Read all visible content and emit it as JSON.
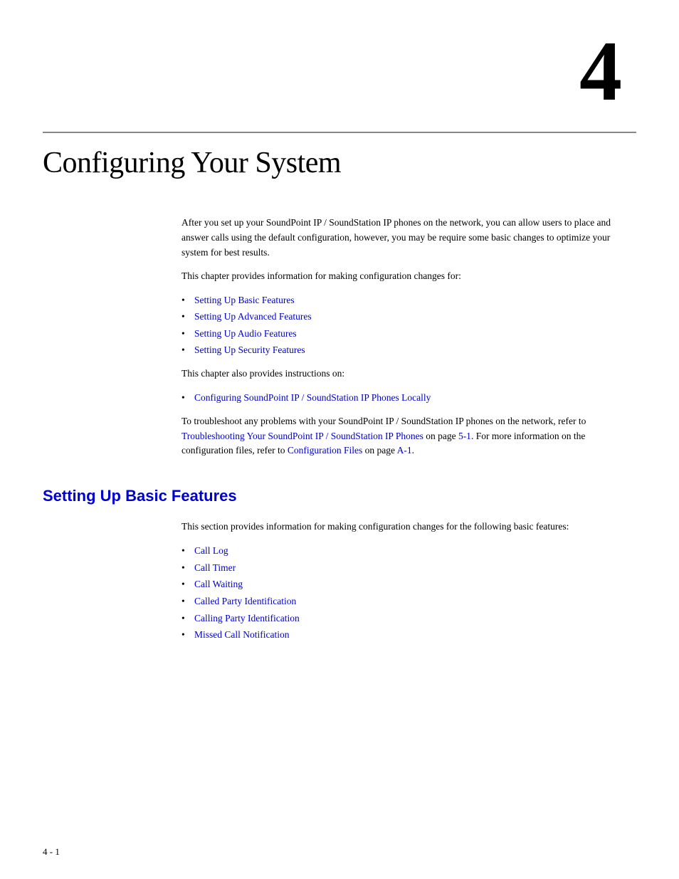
{
  "chapter": {
    "number": "4",
    "title": "Configuring Your System"
  },
  "intro": {
    "paragraph1": "After you set up your SoundPoint IP / SoundStation IP phones on the network, you can allow users to place and answer calls using the default configuration, however, you may be require some basic changes to optimize your system for best results.",
    "paragraph2": "This chapter provides information for making configuration changes for:",
    "bullet_items": [
      {
        "text": "Setting Up Basic Features",
        "href": true
      },
      {
        "text": "Setting Up Advanced Features",
        "href": true
      },
      {
        "text": "Setting Up Audio Features",
        "href": true
      },
      {
        "text": "Setting Up Security Features",
        "href": true
      }
    ],
    "paragraph3": "This chapter also provides instructions on:",
    "bullet_items2": [
      {
        "text": "Configuring SoundPoint IP / SoundStation IP Phones Locally",
        "href": true
      }
    ],
    "paragraph4_start": "To troubleshoot any problems with your SoundPoint IP / SoundStation IP phones on the network, refer to ",
    "paragraph4_link1": "Troubleshooting Your SoundPoint IP / SoundStation IP Phones",
    "paragraph4_mid": " on page ",
    "paragraph4_page1": "5-1",
    "paragraph4_mid2": ". For more information on the configuration files, refer to ",
    "paragraph4_link2": "Configuration Files",
    "paragraph4_mid3": " on page ",
    "paragraph4_page2": "A-1",
    "paragraph4_end": "."
  },
  "basic_features": {
    "heading": "Setting Up Basic Features",
    "paragraph1": "This section provides information for making configuration changes for the following basic features:",
    "bullet_items": [
      {
        "text": "Call Log",
        "href": true
      },
      {
        "text": "Call Timer",
        "href": true
      },
      {
        "text": "Call Waiting",
        "href": true
      },
      {
        "text": "Called Party Identification",
        "href": true
      },
      {
        "text": "Calling Party Identification",
        "href": true
      },
      {
        "text": "Missed Call Notification",
        "href": true
      }
    ]
  },
  "footer": {
    "page_label": "4 - 1"
  }
}
